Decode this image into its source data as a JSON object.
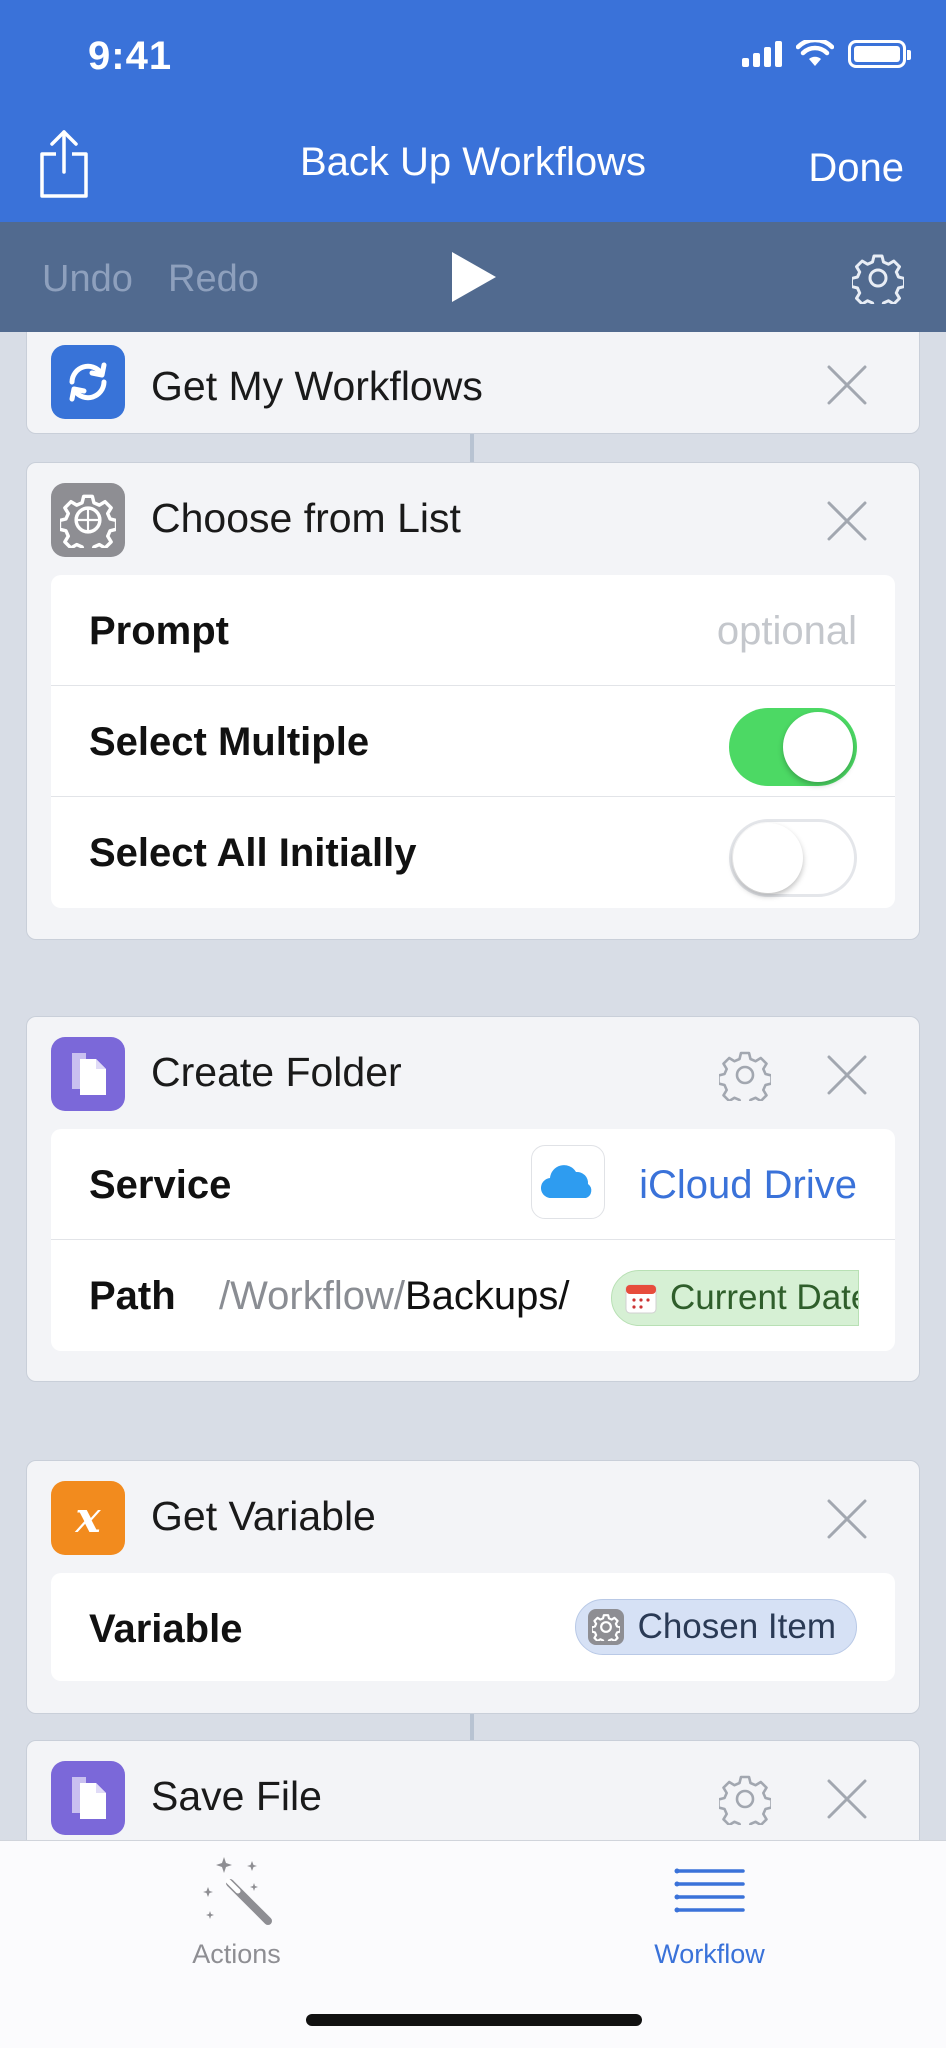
{
  "status_bar": {
    "time": "9:41"
  },
  "nav": {
    "title": "Back Up Workflows",
    "done_label": "Done"
  },
  "toolbar": {
    "undo_label": "Undo",
    "redo_label": "Redo"
  },
  "colors": {
    "header_blue": "#3a72d9",
    "toolbar_slate": "#516a8f",
    "accent_blue": "#3a72d9",
    "toggle_on": "#4cd964",
    "token_green_bg": "#d6f0d4",
    "token_blue_bg": "#d6e1f5"
  },
  "actions": [
    {
      "title": "Get My Workflows",
      "icon": "sync-icon",
      "icon_color": "#3873d8"
    },
    {
      "title": "Choose from List",
      "icon": "gear-icon",
      "icon_color": "#8e8e93",
      "params": {
        "prompt_label": "Prompt",
        "prompt_placeholder": "optional",
        "select_multiple_label": "Select Multiple",
        "select_multiple_on": true,
        "select_all_label": "Select All Initially",
        "select_all_on": false
      }
    },
    {
      "title": "Create Folder",
      "icon": "document-icon",
      "icon_color": "#7b68d9",
      "params": {
        "service_label": "Service",
        "service_value": "iCloud Drive",
        "service_icon": "icloud-icon",
        "path_label": "Path",
        "path_prefix": "/Workflow/",
        "path_value": "Backups/",
        "path_token": "Current Date",
        "path_token_icon": "calendar-icon"
      }
    },
    {
      "title": "Get Variable",
      "icon": "variable-icon",
      "icon_color": "#f28b1e",
      "params": {
        "variable_label": "Variable",
        "variable_token": "Chosen Item",
        "variable_token_icon": "gear-icon"
      }
    },
    {
      "title": "Save File",
      "icon": "document-icon",
      "icon_color": "#7b68d9"
    }
  ],
  "tabs": [
    {
      "label": "Actions",
      "icon": "magic-wand-icon",
      "selected": false
    },
    {
      "label": "Workflow",
      "icon": "list-icon",
      "selected": true
    }
  ]
}
